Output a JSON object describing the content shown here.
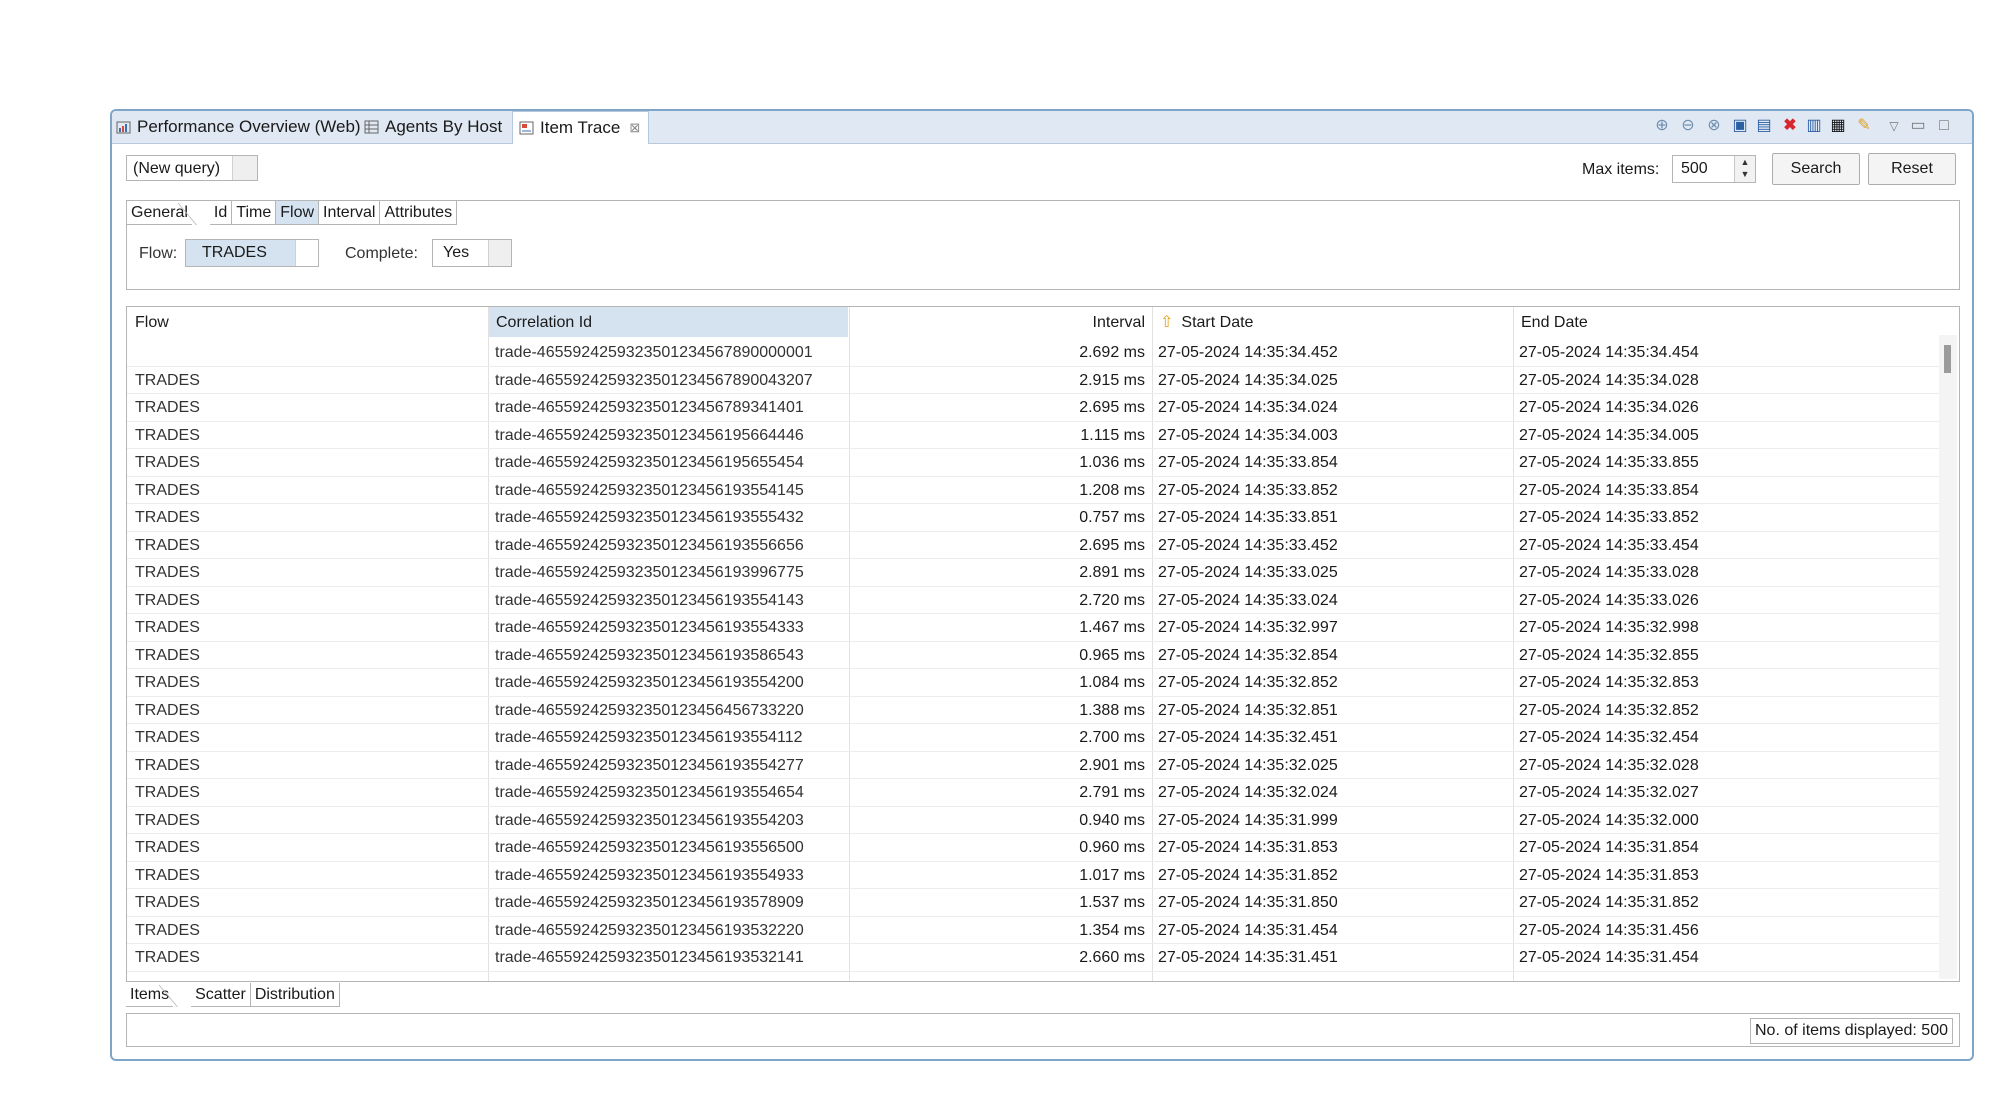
{
  "view_tabs": [
    {
      "label": "Performance Overview (Web)",
      "icon": "chart-icon"
    },
    {
      "label": "Agents By Host",
      "icon": "table-icon"
    },
    {
      "label": "Item Trace",
      "icon": "trace-icon",
      "active": true
    }
  ],
  "toolbar_icons": [
    "zoom-in-icon",
    "zoom-out-icon",
    "zoom-fit-icon",
    "save-icon",
    "save-as-icon",
    "delete-icon",
    "report-icon",
    "export-icon",
    "edit-icon",
    "view-menu-icon",
    "minimize-icon",
    "maximize-icon"
  ],
  "query": {
    "value": "(New query)"
  },
  "max_items": {
    "label": "Max items:",
    "value": "500"
  },
  "buttons": {
    "search": "Search",
    "reset": "Reset"
  },
  "filter_tabs": [
    "General",
    "Id",
    "Time",
    "Flow",
    "Interval",
    "Attributes"
  ],
  "filter_selected_tab": "Flow",
  "filter": {
    "flow_label": "Flow:",
    "flow_value": "TRADES",
    "complete_label": "Complete:",
    "complete_value": "Yes"
  },
  "table": {
    "headers": {
      "flow": "Flow",
      "correlation": "Correlation Id",
      "interval": "Interval",
      "start": "Start Date",
      "end": "End Date"
    },
    "rows": [
      {
        "flow": "",
        "corr": "trade-46559242593235012345678900​00001",
        "interval": "2.692 ms",
        "start": "27-05-2024 14:35:34.452",
        "end": "27-05-2024 14:35:34.454"
      },
      {
        "flow": "TRADES",
        "corr": "trade-4655924259323501234567890043207",
        "interval": "2.915 ms",
        "start": "27-05-2024 14:35:34.025",
        "end": "27-05-2024 14:35:34.028"
      },
      {
        "flow": "TRADES",
        "corr": "trade-4655924259323501234567893414​01",
        "interval": "2.695 ms",
        "start": "27-05-2024 14:35:34.024",
        "end": "27-05-2024 14:35:34.026"
      },
      {
        "flow": "TRADES",
        "corr": "trade-4655924259323501234561956644​46",
        "interval": "1.115 ms",
        "start": "27-05-2024 14:35:34.003",
        "end": "27-05-2024 14:35:34.005"
      },
      {
        "flow": "TRADES",
        "corr": "trade-4655924259323501234561956554​54",
        "interval": "1.036 ms",
        "start": "27-05-2024 14:35:33.854",
        "end": "27-05-2024 14:35:33.855"
      },
      {
        "flow": "TRADES",
        "corr": "trade-4655924259323501234561935541​45",
        "interval": "1.208 ms",
        "start": "27-05-2024 14:35:33.852",
        "end": "27-05-2024 14:35:33.854"
      },
      {
        "flow": "TRADES",
        "corr": "trade-4655924259323501234561935554​32",
        "interval": "0.757 ms",
        "start": "27-05-2024 14:35:33.851",
        "end": "27-05-2024 14:35:33.852"
      },
      {
        "flow": "TRADES",
        "corr": "trade-4655924259323501234561935566​56",
        "interval": "2.695 ms",
        "start": "27-05-2024 14:35:33.452",
        "end": "27-05-2024 14:35:33.454"
      },
      {
        "flow": "TRADES",
        "corr": "trade-4655924259323501234561939967​75",
        "interval": "2.891 ms",
        "start": "27-05-2024 14:35:33.025",
        "end": "27-05-2024 14:35:33.028"
      },
      {
        "flow": "TRADES",
        "corr": "trade-4655924259323501234561935541​43",
        "interval": "2.720 ms",
        "start": "27-05-2024 14:35:33.024",
        "end": "27-05-2024 14:35:33.026"
      },
      {
        "flow": "TRADES",
        "corr": "trade-4655924259323501234561935543​33",
        "interval": "1.467 ms",
        "start": "27-05-2024 14:35:32.997",
        "end": "27-05-2024 14:35:32.998"
      },
      {
        "flow": "TRADES",
        "corr": "trade-4655924259323501234561935865​43",
        "interval": "0.965 ms",
        "start": "27-05-2024 14:35:32.854",
        "end": "27-05-2024 14:35:32.855"
      },
      {
        "flow": "TRADES",
        "corr": "trade-4655924259323501234561935542​00",
        "interval": "1.084 ms",
        "start": "27-05-2024 14:35:32.852",
        "end": "27-05-2024 14:35:32.853"
      },
      {
        "flow": "TRADES",
        "corr": "trade-4655924259323501234564567332​20",
        "interval": "1.388 ms",
        "start": "27-05-2024 14:35:32.851",
        "end": "27-05-2024 14:35:32.852"
      },
      {
        "flow": "TRADES",
        "corr": "trade-4655924259323501234561935541​12",
        "interval": "2.700 ms",
        "start": "27-05-2024 14:35:32.451",
        "end": "27-05-2024 14:35:32.454"
      },
      {
        "flow": "TRADES",
        "corr": "trade-4655924259323501234561935542​77",
        "interval": "2.901 ms",
        "start": "27-05-2024 14:35:32.025",
        "end": "27-05-2024 14:35:32.028"
      },
      {
        "flow": "TRADES",
        "corr": "trade-4655924259323501234561935546​54",
        "interval": "2.791 ms",
        "start": "27-05-2024 14:35:32.024",
        "end": "27-05-2024 14:35:32.027"
      },
      {
        "flow": "TRADES",
        "corr": "trade-4655924259323501234561935542​03",
        "interval": "0.940 ms",
        "start": "27-05-2024 14:35:31.999",
        "end": "27-05-2024 14:35:32.000"
      },
      {
        "flow": "TRADES",
        "corr": "trade-4655924259323501234561935565​00",
        "interval": "0.960 ms",
        "start": "27-05-2024 14:35:31.853",
        "end": "27-05-2024 14:35:31.854"
      },
      {
        "flow": "TRADES",
        "corr": "trade-4655924259323501234561935549​33",
        "interval": "1.017 ms",
        "start": "27-05-2024 14:35:31.852",
        "end": "27-05-2024 14:35:31.853"
      },
      {
        "flow": "TRADES",
        "corr": "trade-4655924259323501234561935789​09",
        "interval": "1.537 ms",
        "start": "27-05-2024 14:35:31.850",
        "end": "27-05-2024 14:35:31.852"
      },
      {
        "flow": "TRADES",
        "corr": "trade-4655924259323501234561935322​20",
        "interval": "1.354 ms",
        "start": "27-05-2024 14:35:31.454",
        "end": "27-05-2024 14:35:31.456"
      },
      {
        "flow": "TRADES",
        "corr": "trade-4655924259323501234561935321​41",
        "interval": "2.660 ms",
        "start": "27-05-2024 14:35:31.451",
        "end": "27-05-2024 14:35:31.454"
      }
    ]
  },
  "bottom_tabs": [
    "Items",
    "Scatter",
    "Distribution"
  ],
  "status": {
    "count_text": "No. of items displayed: 500"
  },
  "colors": {
    "accent": "#7fa6c9",
    "selected_header": "#d5e3f1",
    "tabbar": "#dfe8f3"
  }
}
